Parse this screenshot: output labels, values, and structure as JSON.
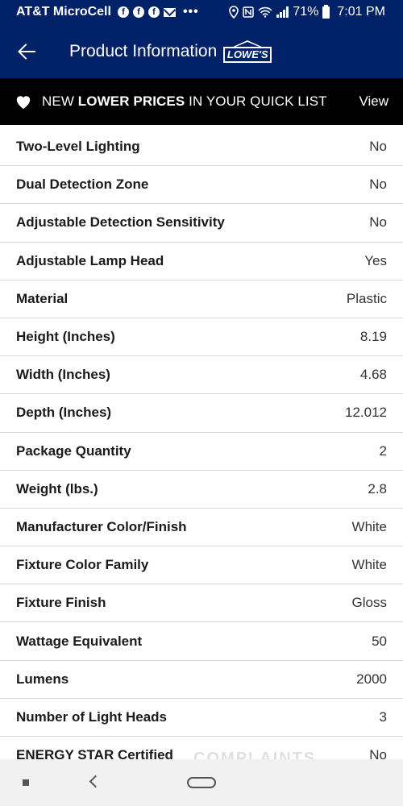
{
  "status_bar": {
    "carrier": "AT&T MicroCell",
    "battery": "71%",
    "time": "7:01 PM",
    "icons": [
      "facebook-icon",
      "facebook-icon",
      "facebook-icon",
      "mail-icon",
      "more-dots-icon",
      "location-icon",
      "nfc-icon",
      "wifi-icon",
      "signal-icon",
      "battery-icon"
    ]
  },
  "header": {
    "title": "Product Information",
    "logo_text": "LOWE'S"
  },
  "promo": {
    "prefix": "NEW ",
    "bold": "LOWER PRICES",
    "suffix": " IN YOUR QUICK LIST",
    "action": "View"
  },
  "specs": [
    {
      "label": "Two-Level Lighting",
      "value": "No"
    },
    {
      "label": "Dual Detection Zone",
      "value": "No"
    },
    {
      "label": "Adjustable Detection Sensitivity",
      "value": "No"
    },
    {
      "label": "Adjustable Lamp Head",
      "value": "Yes"
    },
    {
      "label": "Material",
      "value": "Plastic"
    },
    {
      "label": "Height (Inches)",
      "value": "8.19"
    },
    {
      "label": "Width (Inches)",
      "value": "4.68"
    },
    {
      "label": "Depth (Inches)",
      "value": "12.012"
    },
    {
      "label": "Package Quantity",
      "value": "2"
    },
    {
      "label": "Weight (lbs.)",
      "value": "2.8"
    },
    {
      "label": "Manufacturer Color/Finish",
      "value": "White"
    },
    {
      "label": "Fixture Color Family",
      "value": "White"
    },
    {
      "label": "Fixture Finish",
      "value": "Gloss"
    },
    {
      "label": "Wattage Equivalent",
      "value": "50"
    },
    {
      "label": "Lumens",
      "value": "2000"
    },
    {
      "label": "Number of Light Heads",
      "value": "3"
    },
    {
      "label": "ENERGY STAR Certified",
      "value": "No"
    }
  ],
  "watermark": "COMPLAINTS BOARD",
  "colors": {
    "brand_blue": "#012169",
    "banner_black": "#000000"
  }
}
